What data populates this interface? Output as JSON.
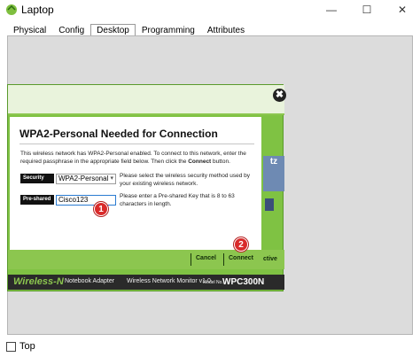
{
  "window": {
    "title": "Laptop",
    "minimize": "—",
    "maximize": "☐",
    "close": "✕"
  },
  "tabs": [
    "Physical",
    "Config",
    "Desktop",
    "Programming",
    "Attributes"
  ],
  "dialog": {
    "close_glyph": "✖",
    "title": "WPA2-Personal Needed for Connection",
    "intro_before": "This wireless network has WPA2-Personal enabled. To connect to this network, enter the required passphrase in the appropriate field below. Then click the ",
    "intro_bold": "Connect",
    "intro_after": " button.",
    "security_label": "Security",
    "security_value": "WPA2-Personal",
    "security_help": "Please select the wireless security method used by your existing wireless network.",
    "psk_label": "Pre-shared Key",
    "psk_value": "Cisco123",
    "psk_help": "Please enter a Pre-shared Key that is 8 to 63 characters in length.",
    "cancel": "Cancel",
    "connect": "Connect",
    "side_text": "tz",
    "side_bottom_text": "ctive"
  },
  "brand": {
    "name": "Wireless-N",
    "adapter": "Notebook Adapter",
    "monitor": "Wireless Network Monitor  v1.0",
    "model_label": "Model No.",
    "model": "WPC300N"
  },
  "badges": {
    "one": "1",
    "two": "2"
  },
  "bottom": {
    "top_label": "Top"
  }
}
